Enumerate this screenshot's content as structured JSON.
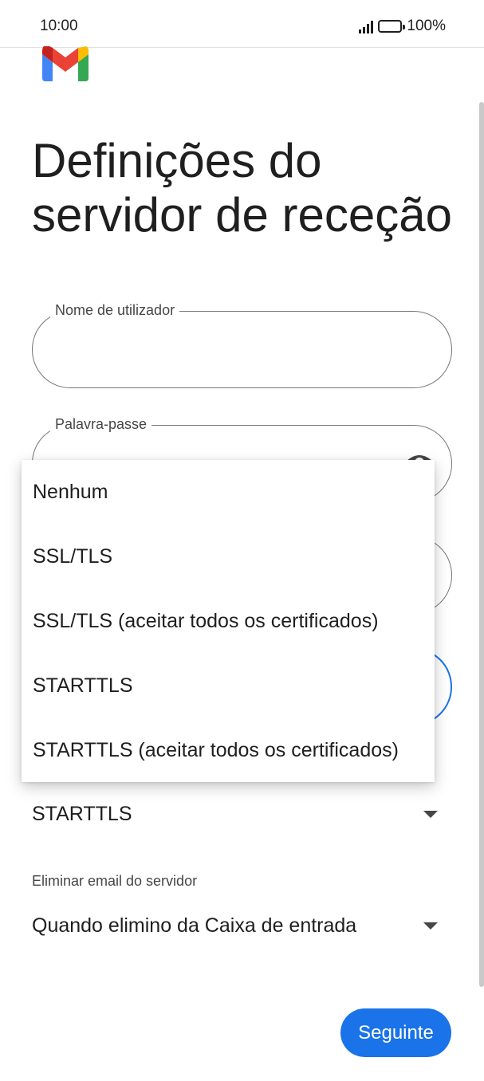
{
  "status_bar": {
    "time": "10:00",
    "battery": "100%"
  },
  "title": "Definições do servidor de receção",
  "fields": {
    "username": {
      "label": "Nome de utilizador",
      "value": ""
    },
    "password": {
      "label": "Palavra-passe",
      "value": ""
    }
  },
  "security_menu": {
    "options": [
      "Nenhum",
      "SSL/TLS",
      "SSL/TLS (aceitar todos os certificados)",
      "STARTTLS",
      "STARTTLS (aceitar todos os certificados)"
    ],
    "selected": "STARTTLS"
  },
  "delete_email": {
    "label": "Eliminar email do servidor",
    "value": "Quando elimino da Caixa de entrada"
  },
  "next_button": "Seguinte",
  "colors": {
    "accent": "#1a73e8",
    "text": "#1f1f1f",
    "outline": "#747775"
  },
  "icons": [
    "gmail-logo",
    "signal-icon",
    "battery-icon",
    "eye-icon",
    "caret-down-icon"
  ]
}
